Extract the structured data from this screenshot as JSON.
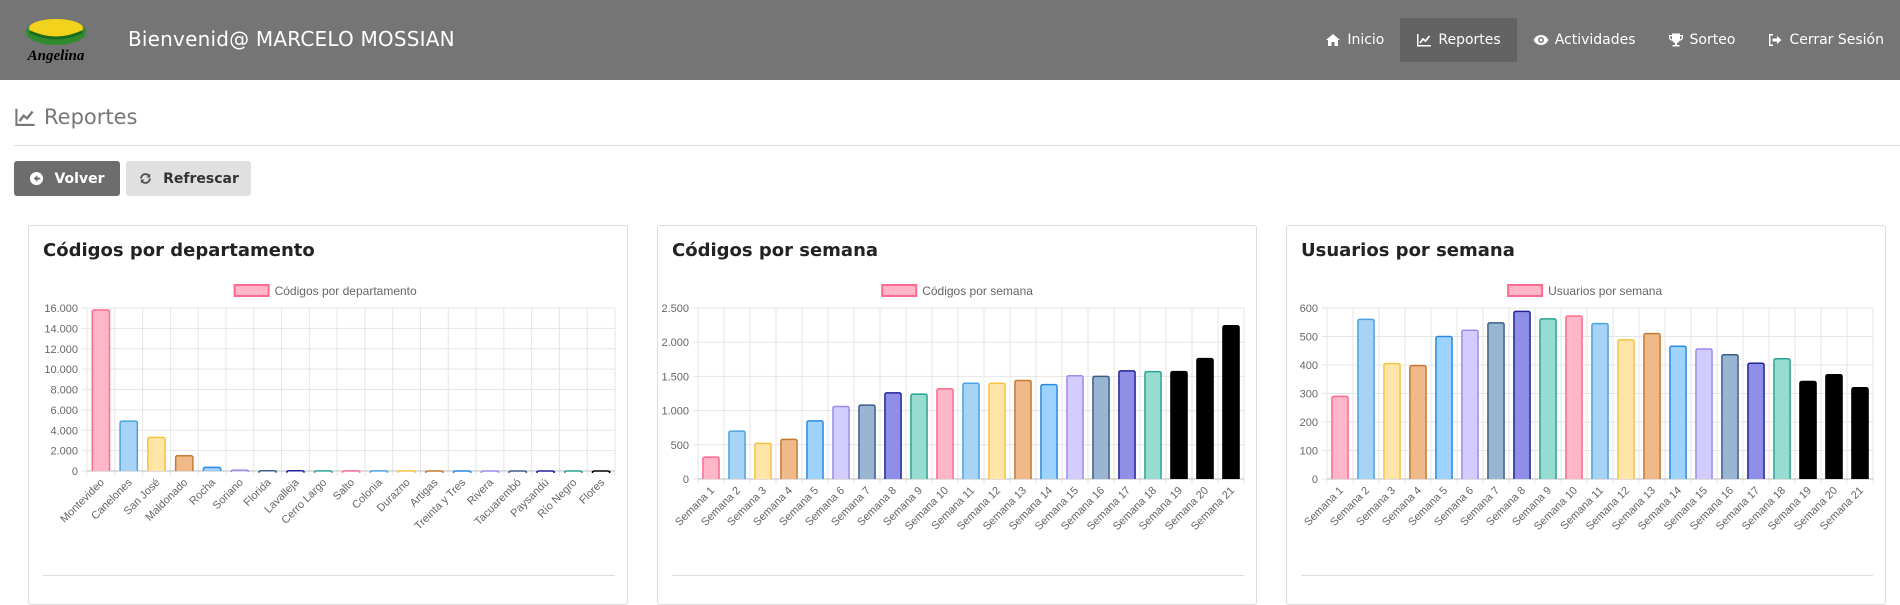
{
  "header": {
    "logo_text": "Angelina",
    "welcome": "Bienvenid@ MARCELO MOSSIAN",
    "nav": [
      {
        "label": "Inicio",
        "icon": "home-icon",
        "active": false
      },
      {
        "label": "Reportes",
        "icon": "line-chart-icon",
        "active": true
      },
      {
        "label": "Actividades",
        "icon": "eye-icon",
        "active": false
      },
      {
        "label": "Sorteo",
        "icon": "trophy-icon",
        "active": false
      },
      {
        "label": "Cerrar Sesión",
        "icon": "sign-out-icon",
        "active": false
      }
    ]
  },
  "page": {
    "title": "Reportes",
    "buttons": {
      "back": "Volver",
      "refresh": "Refrescar"
    }
  },
  "panels": [
    {
      "title": "Códigos por departamento"
    },
    {
      "title": "Códigos por semana"
    },
    {
      "title": "Usuarios por semana"
    }
  ],
  "colors": {
    "pink": "#ffb6c8",
    "pink_border": "#ff6b8e",
    "blue": "#a7d4f5",
    "blue_border": "#4aa3e0",
    "yellow": "#ffe6a8",
    "yellow_border": "#f5c242",
    "orange": "#f0b98a",
    "orange_border": "#c47a32",
    "blue2": "#9fd3ff",
    "blue2_border": "#2b8be0",
    "lavender": "#d3ccff",
    "lavender_border": "#9a8cf0",
    "steel": "#9ab5d2",
    "steel_border": "#3c5f88",
    "indigo": "#8f8fe8",
    "indigo_border": "#22229a",
    "teal": "#96dcd0",
    "teal_border": "#2ca493",
    "black": "#000000",
    "black_border": "#000000"
  },
  "chart_data": [
    {
      "type": "bar",
      "legend": "Códigos por departamento",
      "categories": [
        "Montevideo",
        "Canelones",
        "San José",
        "Maldonado",
        "Rocha",
        "Soriano",
        "Florida",
        "Lavalleja",
        "Cerro Largo",
        "Salto",
        "Colonia",
        "Durazno",
        "Artigas",
        "Treinta y Tres",
        "Rivera",
        "Tacuarembó",
        "Paysandú",
        "Río Negro",
        "Flores"
      ],
      "values": [
        15800,
        4900,
        3300,
        1500,
        350,
        90,
        30,
        20,
        15,
        10,
        10,
        8,
        6,
        5,
        5,
        4,
        3,
        3,
        2
      ],
      "ylim": [
        0,
        16000
      ],
      "yticks": [
        "0",
        "2.000",
        "4.000",
        "6.000",
        "8.000",
        "10.000",
        "12.000",
        "14.000",
        "16.000"
      ],
      "colors": [
        "pink",
        "blue",
        "yellow",
        "orange",
        "blue2",
        "lavender",
        "steel",
        "indigo",
        "teal",
        "pink",
        "blue",
        "yellow",
        "orange",
        "blue2",
        "lavender",
        "steel",
        "indigo",
        "teal",
        "black"
      ]
    },
    {
      "type": "bar",
      "legend": "Códigos por semana",
      "categories": [
        "Semana 1",
        "Semana 2",
        "Semana 3",
        "Semana 4",
        "Semana 5",
        "Semana 6",
        "Semana 7",
        "Semana 8",
        "Semana 9",
        "Semana 10",
        "Semana 11",
        "Semana 12",
        "Semana 13",
        "Semana 14",
        "Semana 15",
        "Semana 16",
        "Semana 17",
        "Semana 18",
        "Semana 19",
        "Semana 20",
        "Semana 21"
      ],
      "values": [
        320,
        700,
        520,
        580,
        850,
        1060,
        1080,
        1260,
        1240,
        1320,
        1400,
        1400,
        1440,
        1380,
        1510,
        1500,
        1580,
        1570,
        1570,
        1760,
        2240
      ],
      "ylim": [
        0,
        2500
      ],
      "yticks": [
        "0",
        "500",
        "1.000",
        "1.500",
        "2.000",
        "2.500"
      ],
      "colors": [
        "pink",
        "blue",
        "yellow",
        "orange",
        "blue2",
        "lavender",
        "steel",
        "indigo",
        "teal",
        "pink",
        "blue",
        "yellow",
        "orange",
        "blue2",
        "lavender",
        "steel",
        "indigo",
        "teal",
        "black",
        "black",
        "black"
      ]
    },
    {
      "type": "bar",
      "legend": "Usuarios por semana",
      "categories": [
        "Semana 1",
        "Semana 2",
        "Semana 3",
        "Semana 4",
        "Semana 5",
        "Semana 6",
        "Semana 7",
        "Semana 8",
        "Semana 9",
        "Semana 10",
        "Semana 11",
        "Semana 12",
        "Semana 13",
        "Semana 14",
        "Semana 15",
        "Semana 16",
        "Semana 17",
        "Semana 18",
        "Semana 19",
        "Semana 20",
        "Semana 21"
      ],
      "values": [
        290,
        560,
        405,
        398,
        500,
        522,
        548,
        588,
        562,
        572,
        545,
        488,
        510,
        466,
        456,
        436,
        406,
        422,
        342,
        366,
        320
      ],
      "ylim": [
        0,
        600
      ],
      "yticks": [
        "0",
        "100",
        "200",
        "300",
        "400",
        "500",
        "600"
      ],
      "colors": [
        "pink",
        "blue",
        "yellow",
        "orange",
        "blue2",
        "lavender",
        "steel",
        "indigo",
        "teal",
        "pink",
        "blue",
        "yellow",
        "orange",
        "blue2",
        "lavender",
        "steel",
        "indigo",
        "teal",
        "black",
        "black",
        "black"
      ]
    }
  ]
}
